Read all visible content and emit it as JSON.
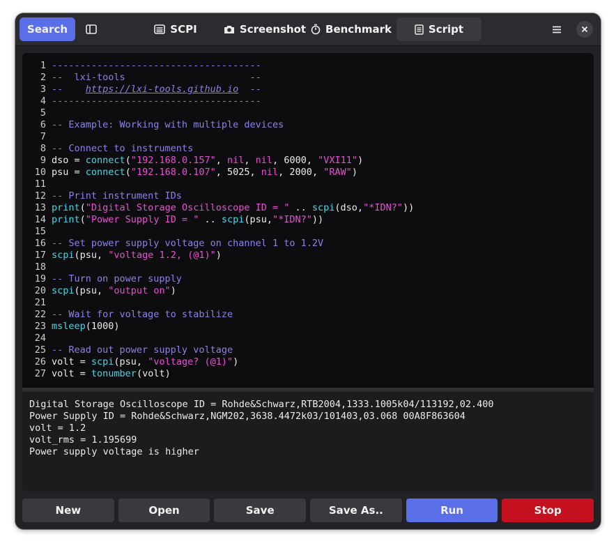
{
  "header": {
    "search_label": "Search",
    "tabs": [
      {
        "label": "SCPI",
        "icon": "terminal-icon"
      },
      {
        "label": "Screenshot",
        "icon": "camera-icon"
      },
      {
        "label": "Benchmark",
        "icon": "stopwatch-icon"
      },
      {
        "label": "Script",
        "icon": "document-icon",
        "active": true
      }
    ]
  },
  "editor": {
    "lines": [
      [
        {
          "t": "-------------------------------------",
          "c": "comment"
        }
      ],
      [
        {
          "t": "--  lxi-tools                      --",
          "c": "comment"
        }
      ],
      [
        {
          "t": "--    ",
          "c": "comment"
        },
        {
          "t": "https://lxi-tools.github.io",
          "c": "link"
        },
        {
          "t": "  --",
          "c": "comment"
        }
      ],
      [
        {
          "t": "-------------------------------------",
          "c": "comment"
        }
      ],
      [],
      [
        {
          "t": "-- Example: Working with multiple devices",
          "c": "comment"
        }
      ],
      [],
      [
        {
          "t": "-- Connect to instruments",
          "c": "comment"
        }
      ],
      [
        {
          "t": "dso = ",
          "c": "plain"
        },
        {
          "t": "connect",
          "c": "fn"
        },
        {
          "t": "(",
          "c": "plain"
        },
        {
          "t": "\"192.168.0.157\"",
          "c": "str"
        },
        {
          "t": ", ",
          "c": "plain"
        },
        {
          "t": "nil",
          "c": "nil"
        },
        {
          "t": ", ",
          "c": "plain"
        },
        {
          "t": "nil",
          "c": "nil"
        },
        {
          "t": ", 6000, ",
          "c": "plain"
        },
        {
          "t": "\"VXI11\"",
          "c": "str"
        },
        {
          "t": ")",
          "c": "plain"
        }
      ],
      [
        {
          "t": "psu = ",
          "c": "plain"
        },
        {
          "t": "connect",
          "c": "fn"
        },
        {
          "t": "(",
          "c": "plain"
        },
        {
          "t": "\"192.168.0.107\"",
          "c": "str"
        },
        {
          "t": ", 5025, ",
          "c": "plain"
        },
        {
          "t": "nil",
          "c": "nil"
        },
        {
          "t": ", 2000, ",
          "c": "plain"
        },
        {
          "t": "\"RAW\"",
          "c": "str"
        },
        {
          "t": ")",
          "c": "plain"
        }
      ],
      [],
      [
        {
          "t": "-- Print instrument IDs",
          "c": "comment"
        }
      ],
      [
        {
          "t": "print",
          "c": "fn"
        },
        {
          "t": "(",
          "c": "plain"
        },
        {
          "t": "\"Digital Storage Oscilloscope ID = \"",
          "c": "str"
        },
        {
          "t": " .. ",
          "c": "plain"
        },
        {
          "t": "scpi",
          "c": "fn"
        },
        {
          "t": "(dso,",
          "c": "plain"
        },
        {
          "t": "\"*IDN?\"",
          "c": "str"
        },
        {
          "t": "))",
          "c": "plain"
        }
      ],
      [
        {
          "t": "print",
          "c": "fn"
        },
        {
          "t": "(",
          "c": "plain"
        },
        {
          "t": "\"Power Supply ID = \"",
          "c": "str"
        },
        {
          "t": " .. ",
          "c": "plain"
        },
        {
          "t": "scpi",
          "c": "fn"
        },
        {
          "t": "(psu,",
          "c": "plain"
        },
        {
          "t": "\"*IDN?\"",
          "c": "str"
        },
        {
          "t": "))",
          "c": "plain"
        }
      ],
      [],
      [
        {
          "t": "-- Set power supply voltage on channel 1 to 1.2V",
          "c": "comment"
        }
      ],
      [
        {
          "t": "scpi",
          "c": "fn"
        },
        {
          "t": "(psu, ",
          "c": "plain"
        },
        {
          "t": "\"voltage 1.2, (@1)\"",
          "c": "str"
        },
        {
          "t": ")",
          "c": "plain"
        }
      ],
      [],
      [
        {
          "t": "-- Turn on power supply",
          "c": "comment"
        }
      ],
      [
        {
          "t": "scpi",
          "c": "fn"
        },
        {
          "t": "(psu, ",
          "c": "plain"
        },
        {
          "t": "\"output on\"",
          "c": "str"
        },
        {
          "t": ")",
          "c": "plain"
        }
      ],
      [],
      [
        {
          "t": "-- Wait for voltage to stabilize",
          "c": "comment"
        }
      ],
      [
        {
          "t": "msleep",
          "c": "fn"
        },
        {
          "t": "(1000)",
          "c": "plain"
        }
      ],
      [],
      [
        {
          "t": "-- Read out power supply voltage",
          "c": "comment"
        }
      ],
      [
        {
          "t": "volt = ",
          "c": "plain"
        },
        {
          "t": "scpi",
          "c": "fn"
        },
        {
          "t": "(psu, ",
          "c": "plain"
        },
        {
          "t": "\"voltage? (@1)\"",
          "c": "str"
        },
        {
          "t": ")",
          "c": "plain"
        }
      ],
      [
        {
          "t": "volt = ",
          "c": "plain"
        },
        {
          "t": "tonumber",
          "c": "fn"
        },
        {
          "t": "(volt)",
          "c": "plain"
        }
      ]
    ]
  },
  "output": {
    "lines": [
      "Digital Storage Oscilloscope ID = Rohde&Schwarz,RTB2004,1333.1005k04/113192,02.400",
      "Power Supply ID = Rohde&Schwarz,NGM202,3638.4472k03/101403,03.068 00A8F863604",
      "volt = 1.2",
      "volt_rms = 1.195699",
      "Power supply voltage is higher"
    ]
  },
  "footer": {
    "new_label": "New",
    "open_label": "Open",
    "save_label": "Save",
    "save_as_label": "Save As..",
    "run_label": "Run",
    "stop_label": "Stop"
  },
  "colors": {
    "accent": "#5a6ee8",
    "stop": "#c4101f",
    "comment": "#8c82e6",
    "string": "#e84fd2",
    "function": "#40d8e8"
  }
}
